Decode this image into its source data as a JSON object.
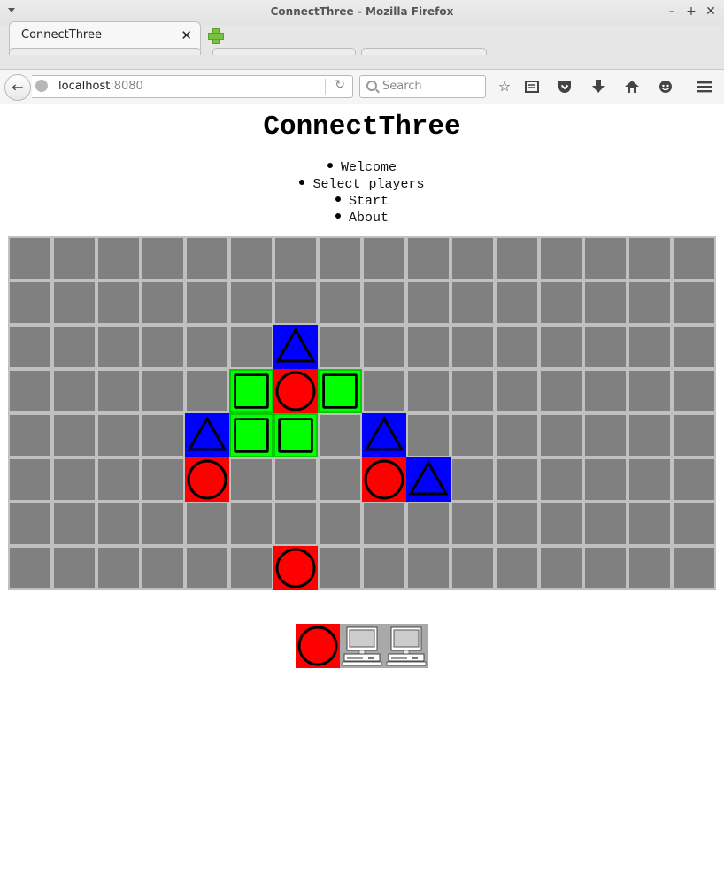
{
  "window": {
    "title": "ConnectThree - Mozilla Firefox",
    "minimize_icon": "minimize-icon",
    "maximize_icon": "maximize-icon",
    "close_icon": "close-icon"
  },
  "tabs": [
    {
      "label": "ConnectThree",
      "active": true
    }
  ],
  "navbar": {
    "url_host": "localhost",
    "url_port": ":8080",
    "search_placeholder": "Search"
  },
  "page": {
    "title": "ConnectThree",
    "nav": [
      "Welcome",
      "Select players",
      "Start",
      "About"
    ]
  },
  "colors": {
    "cell": "#808080",
    "grid": "#c0c0c0",
    "red": "#ff0000",
    "blue": "#0000ff",
    "green": "#00ff00",
    "computer_bg": "#a9a9a9"
  },
  "board": {
    "cols": 16,
    "rows": 8,
    "pieces": [
      {
        "row": 2,
        "col": 6,
        "piece": "triangle",
        "color": "blue"
      },
      {
        "row": 3,
        "col": 5,
        "piece": "square",
        "color": "green"
      },
      {
        "row": 3,
        "col": 6,
        "piece": "circle",
        "color": "red"
      },
      {
        "row": 3,
        "col": 7,
        "piece": "square",
        "color": "green"
      },
      {
        "row": 4,
        "col": 4,
        "piece": "triangle",
        "color": "blue"
      },
      {
        "row": 4,
        "col": 5,
        "piece": "square",
        "color": "green"
      },
      {
        "row": 4,
        "col": 6,
        "piece": "square",
        "color": "green"
      },
      {
        "row": 4,
        "col": 8,
        "piece": "triangle",
        "color": "blue"
      },
      {
        "row": 5,
        "col": 4,
        "piece": "circle",
        "color": "red"
      },
      {
        "row": 5,
        "col": 8,
        "piece": "circle",
        "color": "red"
      },
      {
        "row": 5,
        "col": 9,
        "piece": "triangle",
        "color": "blue"
      },
      {
        "row": 7,
        "col": 6,
        "piece": "circle",
        "color": "red"
      }
    ]
  },
  "players": [
    {
      "type": "circle",
      "color": "red",
      "current": true
    },
    {
      "type": "computer-icon"
    },
    {
      "type": "computer-icon"
    }
  ]
}
